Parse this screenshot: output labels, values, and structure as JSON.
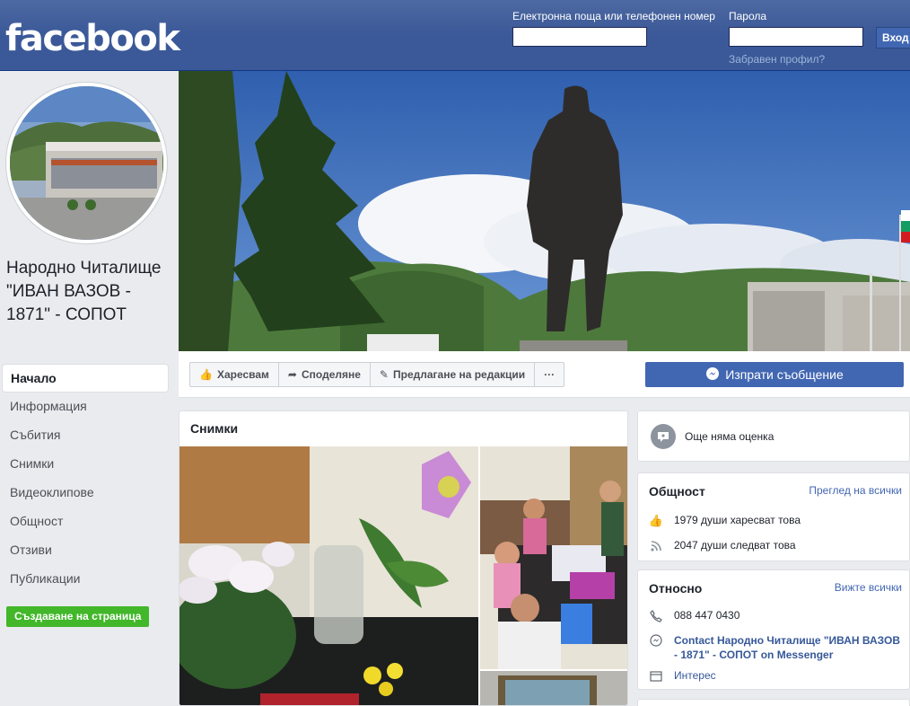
{
  "header": {
    "logo": "facebook",
    "email_label": "Електронна поща или телефонен номер",
    "password_label": "Парола",
    "login_button": "Вход",
    "forgot_link": "Забравен профил?",
    "email_value": "",
    "password_value": ""
  },
  "page": {
    "name": "Народно Читалище \"ИВАН ВАЗОВ - 1871\" - СОПОТ"
  },
  "nav": {
    "items": [
      "Начало",
      "Информация",
      "Събития",
      "Снимки",
      "Видеоклипове",
      "Общност",
      "Отзиви",
      "Публикации"
    ],
    "create_page": "Създаване на страница"
  },
  "actions": {
    "like": "Харесвам",
    "share": "Споделяне",
    "suggest": "Предлагане на редакции",
    "more": "···",
    "send_message": "Изпрати съобщение"
  },
  "photos": {
    "title": "Снимки"
  },
  "rating": {
    "text": "Още няма оценка"
  },
  "community": {
    "title": "Общност",
    "see_all": "Преглед на всички",
    "likes": "1979 души харесват това",
    "follows": "2047 души следват това"
  },
  "about": {
    "title": "Относно",
    "see_all": "Вижте всички",
    "phone": "088 447 0430",
    "messenger": "Contact Народно Читалище \"ИВАН ВАЗОВ - 1871\" - СОПОТ on Messenger",
    "category": "Интерес"
  },
  "colors": {
    "brand": "#3b5998",
    "button": "#4267b2",
    "create": "#42b72a",
    "background": "#e9ebee"
  }
}
